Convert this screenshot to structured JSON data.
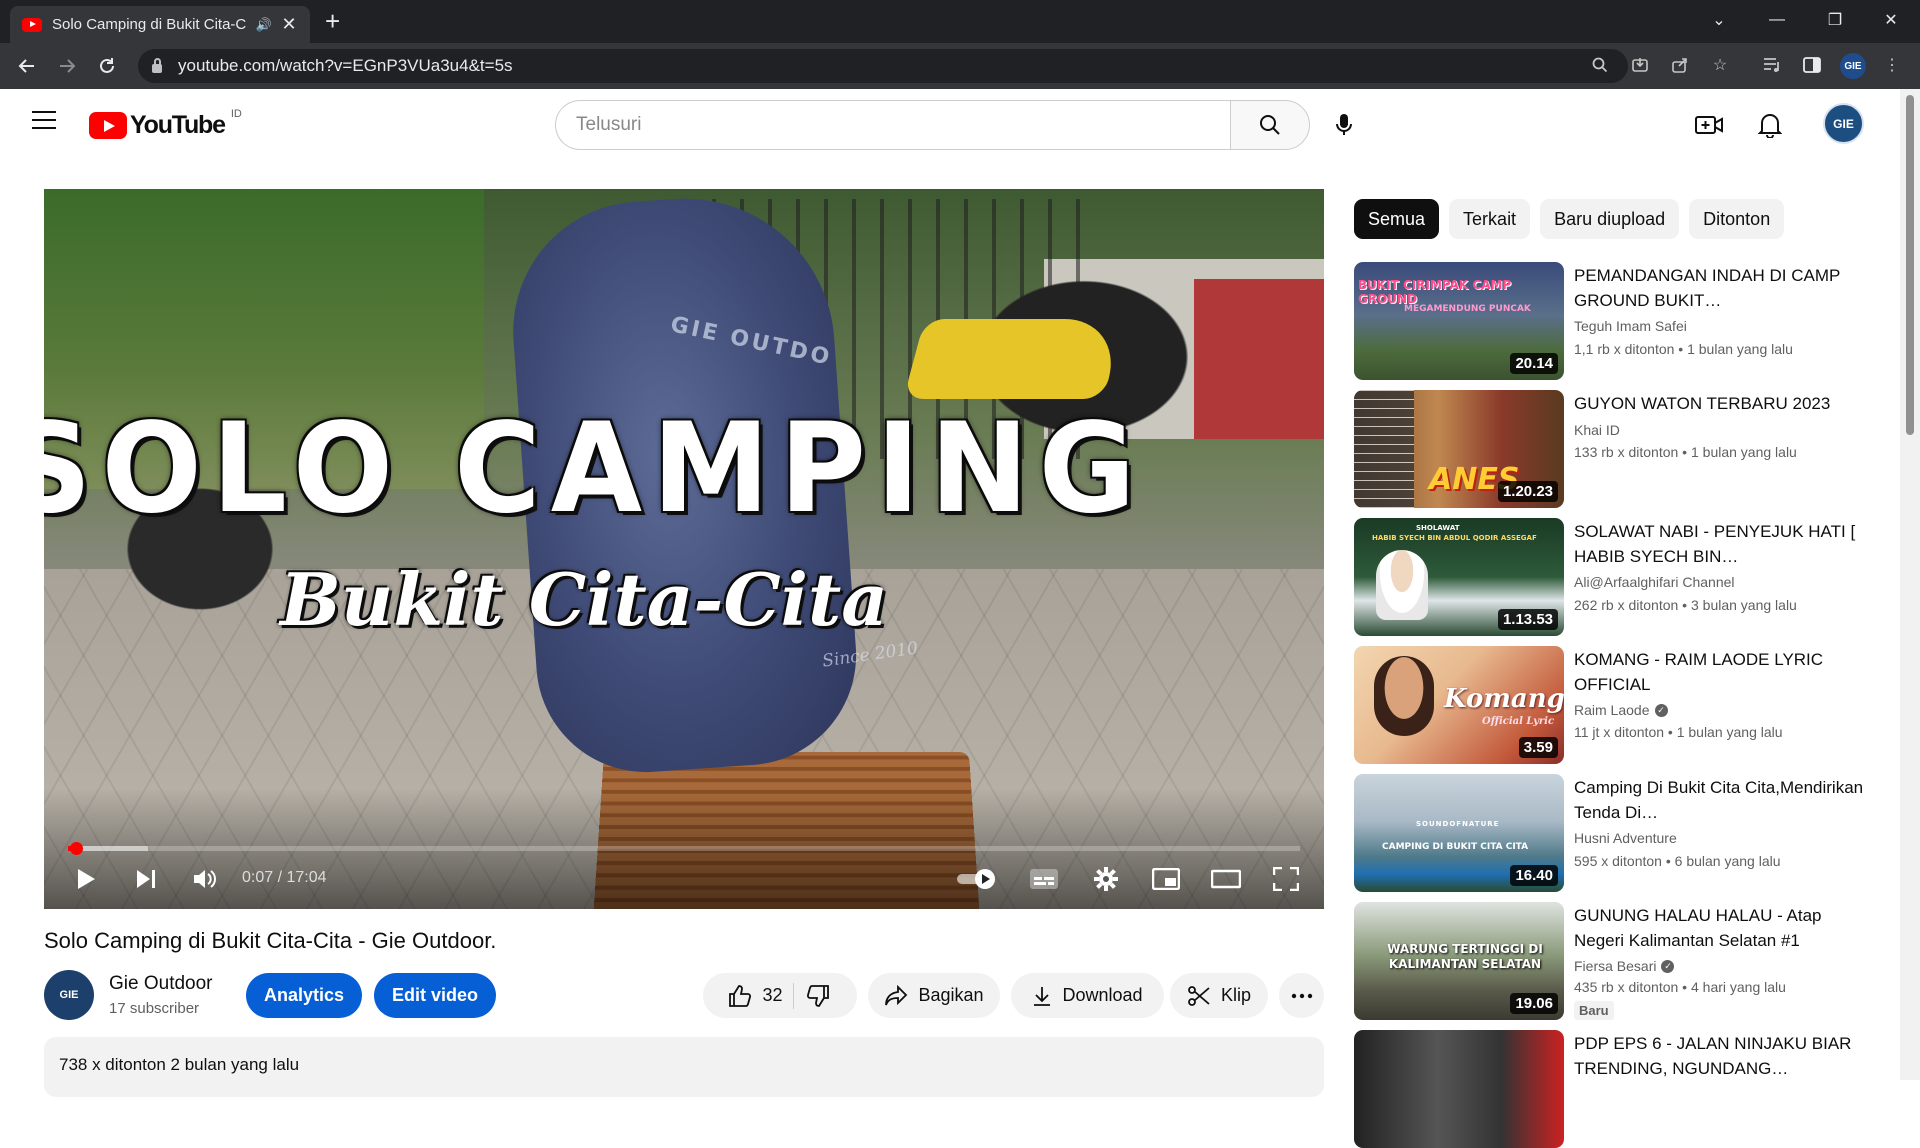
{
  "browser": {
    "tab_title": "Solo Camping di Bukit Cita-C",
    "url": "youtube.com/watch?v=EGnP3VUa3u4&t=5s",
    "profile_initials": "GIE"
  },
  "masthead": {
    "logo_text": "YouTube",
    "country_code": "ID",
    "search_placeholder": "Telusuri",
    "avatar_initials": "GIE"
  },
  "player": {
    "overlay_title": "SOLO CAMPING",
    "overlay_subtitle": "Bukit Cita-Cita",
    "bag_text": "GIE OUTDO",
    "since_text": "Since 2010",
    "current_time": "0:07",
    "duration": "17:04",
    "time_display": "0:07 / 17:04",
    "progress_fraction": 0.0068,
    "buffer_fraction": 0.065
  },
  "video": {
    "title": "Solo Camping di Bukit Cita-Cita - Gie Outdoor.",
    "channel_name": "Gie Outdoor",
    "channel_subs": "17 subscriber",
    "channel_initials": "GIE",
    "analytics_label": "Analytics",
    "edit_label": "Edit video",
    "like_count": "32",
    "share_label": "Bagikan",
    "download_label": "Download",
    "clip_label": "Klip",
    "description_meta": "738 x ditonton  2 bulan yang lalu"
  },
  "chips": [
    "Semua",
    "Terkait",
    "Baru diupload",
    "Ditonton"
  ],
  "recommendations": [
    {
      "title": "PEMANDANGAN INDAH DI CAMP GROUND BUKIT…",
      "channel": "Teguh Imam Safei",
      "verified": false,
      "meta": "1,1 rb x ditonton  • 1 bulan yang lalu",
      "duration": "20.14",
      "thumb_text": "BUKIT CIRIMPAK CAMP GROUND",
      "thumb_sub": "MEGAMENDUNG PUNCAK"
    },
    {
      "title": "GUYON WATON TERBARU 2023",
      "channel": "Khai ID",
      "verified": false,
      "meta": "133 rb x ditonton  • 1 bulan yang lalu",
      "duration": "1.20.23",
      "thumb_text": "ANES",
      "thumb_sub": ""
    },
    {
      "title": "SOLAWAT NABI - PENYEJUK HATI [ HABIB SYECH BIN…",
      "channel": "Ali@Arfaalghifari Channel",
      "verified": false,
      "meta": "262 rb x ditonton  • 3 bulan yang lalu",
      "duration": "1.13.53",
      "thumb_text": "HABIB SYECH BIN ABDUL QODIR ASSEGAF",
      "thumb_sub": "SHOLAWAT"
    },
    {
      "title": "KOMANG - RAIM LAODE LYRIC OFFICIAL",
      "channel": "Raim Laode",
      "verified": true,
      "meta": "11 jt x ditonton  • 1 bulan yang lalu",
      "duration": "3.59",
      "thumb_text": "Komang",
      "thumb_sub": "Official Lyric"
    },
    {
      "title": "Camping Di Bukit Cita Cita,Mendirikan Tenda Di…",
      "channel": "Husni Adventure",
      "verified": false,
      "meta": "595 x ditonton  • 6 bulan yang lalu",
      "duration": "16.40",
      "thumb_text": "CAMPING DI BUKIT CITA CITA",
      "thumb_sub": "SOUNDOFNATURE"
    },
    {
      "title": "GUNUNG HALAU HALAU - Atap Negeri Kalimantan Selatan #1",
      "channel": "Fiersa Besari",
      "verified": true,
      "meta": "435 rb x ditonton  • 4 hari yang lalu",
      "duration": "19.06",
      "thumb_text": "WARUNG TERTINGGI DI KALIMANTAN SELATAN",
      "thumb_sub": "",
      "badge": "Baru"
    },
    {
      "title": "PDP EPS 6 - JALAN NINJAKU BIAR TRENDING, NGUNDANG…",
      "channel": "",
      "verified": false,
      "meta": "",
      "duration": "",
      "thumb_text": "",
      "thumb_sub": ""
    }
  ],
  "colors": {
    "brand_red": "#ff0000",
    "accent_blue": "#065fd4",
    "chrome_dark": "#202124"
  }
}
